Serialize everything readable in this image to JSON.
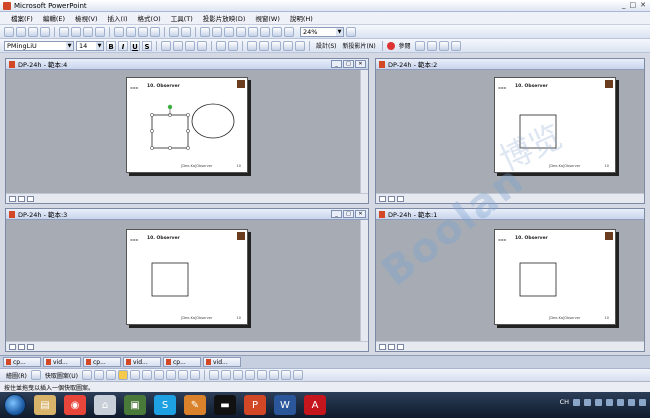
{
  "window": {
    "title": "Microsoft PowerPoint",
    "min": "_",
    "max": "□",
    "close": "✕"
  },
  "menu": [
    "檔案(F)",
    "編輯(E)",
    "檢視(V)",
    "插入(I)",
    "格式(O)",
    "工具(T)",
    "投影片放映(D)",
    "視窗(W)",
    "說明(H)"
  ],
  "toolbar": {
    "zoom": "24%",
    "font": "PMingLiU",
    "font_size": "14",
    "bold": "B",
    "italic": "I",
    "underline": "U",
    "shadow": "S",
    "design_label": "設計(S)",
    "new_slide_label": "新投影片(N)",
    "reference_label": "參閱"
  },
  "panes": [
    {
      "title": "DP-24h - 範本:4",
      "slide_title": "10. Observer",
      "footer": "[Dee-Ka]Observer",
      "number": "10"
    },
    {
      "title": "DP-24h - 範本:2",
      "slide_title": "10. Observer",
      "footer": "[Dee-Ka]Observer",
      "number": "10"
    },
    {
      "title": "DP-24h - 範本:3",
      "slide_title": "10. Observer",
      "footer": "[Dee-Ka]Observer",
      "number": "10"
    },
    {
      "title": "DP-24h - 範本:1",
      "slide_title": "10. Observer",
      "footer": "[Dee-Ka]Observer",
      "number": "10"
    }
  ],
  "doc_tabs": [
    "cp...",
    "vid...",
    "cp...",
    "vid...",
    "cp...",
    "vid..."
  ],
  "drawbar": {
    "draw_label": "繪圖(R)",
    "autoshape_label": "快取圖案(U)"
  },
  "status": {
    "hint": "按住並拖曳以插入一個快取圖案。"
  },
  "tray": {
    "lang": "CH",
    "clock": ""
  },
  "watermark": {
    "text": "Boolan",
    "text2": "博览"
  },
  "colors": {
    "accent": "#d24726",
    "taskbar": "#1c2b42"
  }
}
